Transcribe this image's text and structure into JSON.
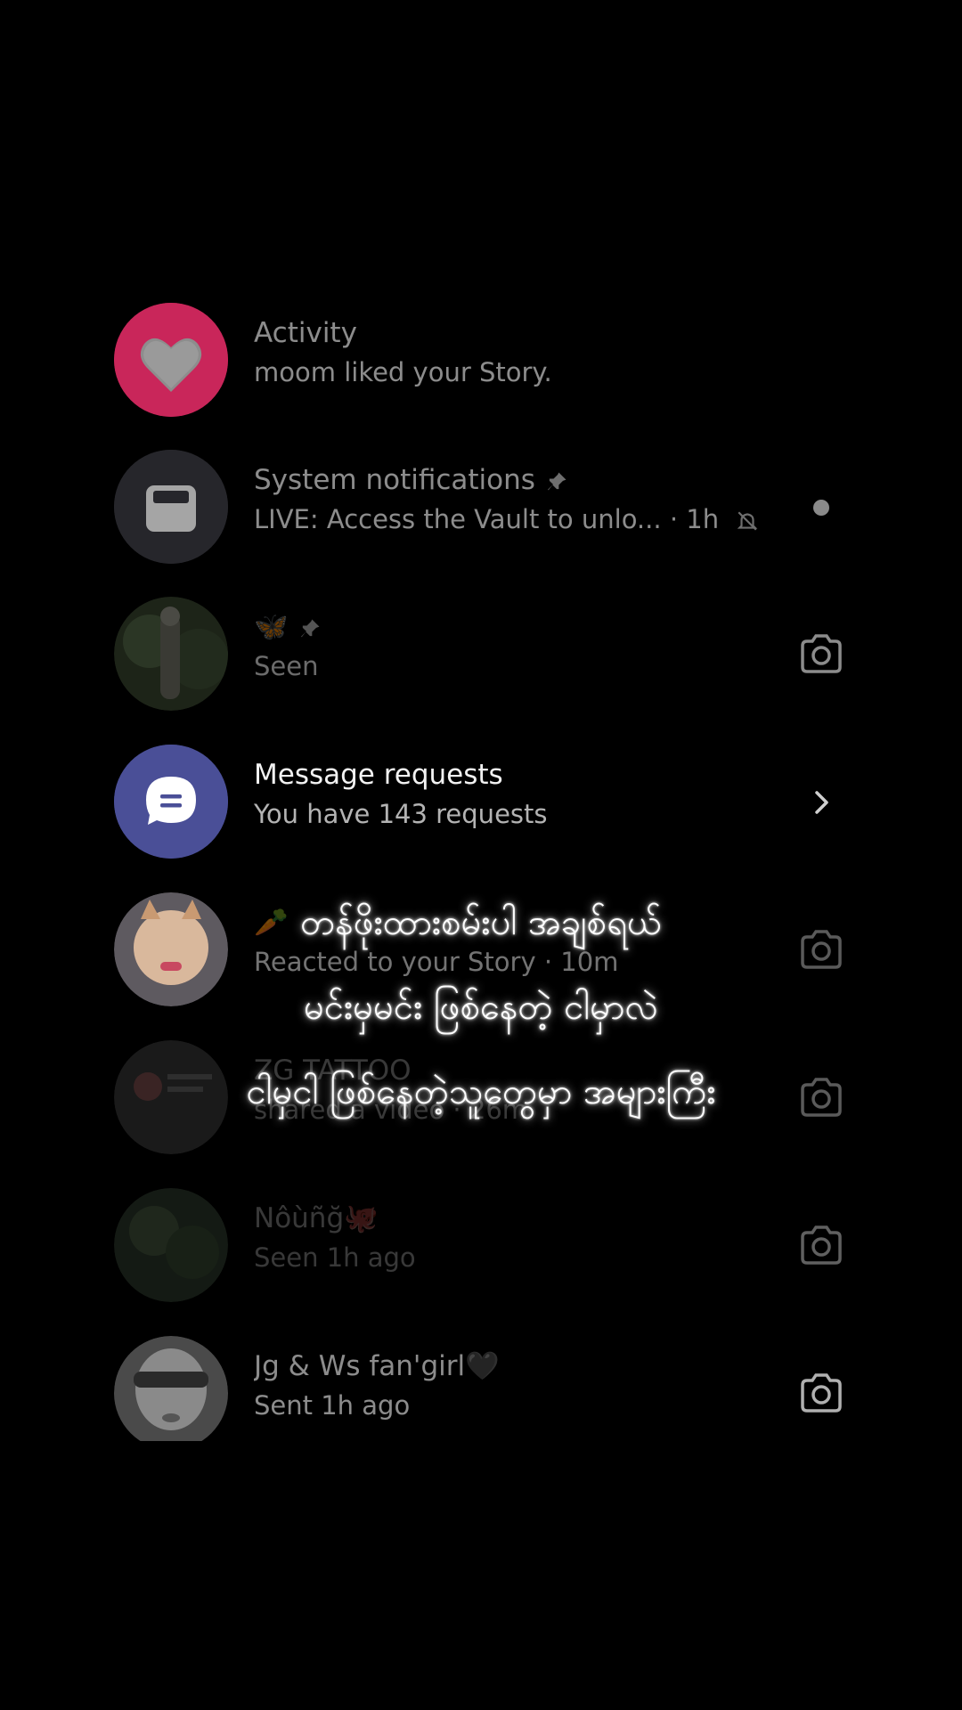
{
  "conversations": [
    {
      "title": "Activity",
      "subtitle": "moom liked your Story.",
      "avatar_icon": "heart-icon",
      "avatar_color": "#c9265a"
    },
    {
      "title": "System notifications",
      "subtitle": "LIVE: Access the Vault to unlo...",
      "time": "· 1h",
      "avatar_icon": "inbox-icon",
      "avatar_color": "#2b2b30"
    },
    {
      "title": "🦋",
      "subtitle": "Seen"
    },
    {
      "title": "Message requests",
      "subtitle": "You have 143 requests",
      "avatar_icon": "chat-bubble-icon",
      "avatar_color": "#4a4f97"
    },
    {
      "title": "🥕",
      "subtitle": "Reacted to your Story · 10m"
    },
    {
      "title": "ZG TATTOO",
      "subtitle": "shared a video · 26m"
    },
    {
      "title": "Nôùñğ🐙",
      "subtitle": "Seen 1h ago"
    },
    {
      "title": "Jg & Ws fan'girl🖤",
      "subtitle": "Sent 1h ago"
    }
  ],
  "overlay": {
    "line1": "တန်ဖိုးထားစမ်းပါ အချစ်ရယ်",
    "line2": "မင်းမှမင်း ဖြစ်နေတဲ့ ငါမှာလဲ",
    "line3": "ငါမှငါ ဖြစ်နေတဲ့သူတွေမှာ အများကြီး"
  }
}
